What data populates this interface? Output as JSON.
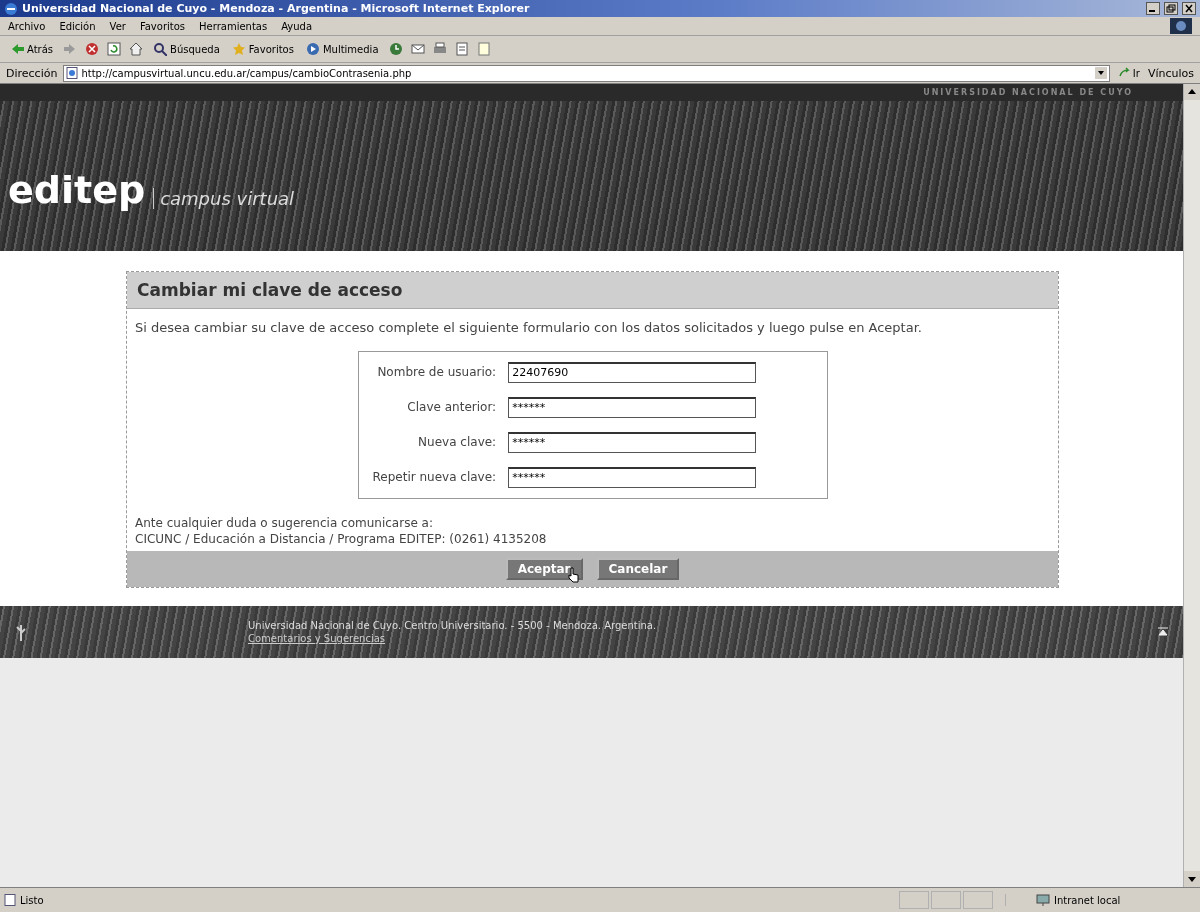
{
  "window": {
    "title": "Universidad Nacional de Cuyo - Mendoza - Argentina - Microsoft Internet Explorer"
  },
  "menu": [
    "Archivo",
    "Edición",
    "Ver",
    "Favoritos",
    "Herramientas",
    "Ayuda"
  ],
  "toolbar": [
    {
      "label": "Atrás",
      "kind": "back"
    },
    {
      "label": "Búsqueda",
      "kind": "search"
    },
    {
      "label": "Favoritos",
      "kind": "favorites"
    },
    {
      "label": "Multimedia",
      "kind": "media"
    }
  ],
  "address": {
    "label": "Dirección",
    "value": "http://campusvirtual.uncu.edu.ar/campus/cambioContrasenia.php",
    "go": "Ir",
    "links": "Vínculos"
  },
  "site": {
    "top_label": "UNIVERSIDAD NACIONAL DE CUYO",
    "logo": "editep",
    "subtitle": "campus virtual"
  },
  "form": {
    "title": "Cambiar mi clave de acceso",
    "intro": "Si desea cambiar su clave de acceso complete el siguiente formulario con los datos solicitados y luego pulse en Aceptar.",
    "fields": [
      {
        "label": "Nombre de usuario:",
        "value": "22407690"
      },
      {
        "label": "Clave anterior:",
        "value": "******"
      },
      {
        "label": "Nueva clave:",
        "value": "******"
      },
      {
        "label": "Repetir nueva clave:",
        "value": "******"
      }
    ],
    "contact": [
      "Ante cualquier duda o sugerencia comunicarse a:",
      "CICUNC / Educación a Distancia / Programa EDITEP: (0261) 4135208"
    ],
    "buttons": [
      "Aceptar",
      "Cancelar"
    ]
  },
  "footer": {
    "address": "Universidad Nacional de Cuyo. Centro Universitario. - 5500 - Mendoza. Argentina.",
    "link": "Comentarios y Sugerencias"
  },
  "status_bar": {
    "text": "Listo",
    "zone": "Intranet local"
  }
}
